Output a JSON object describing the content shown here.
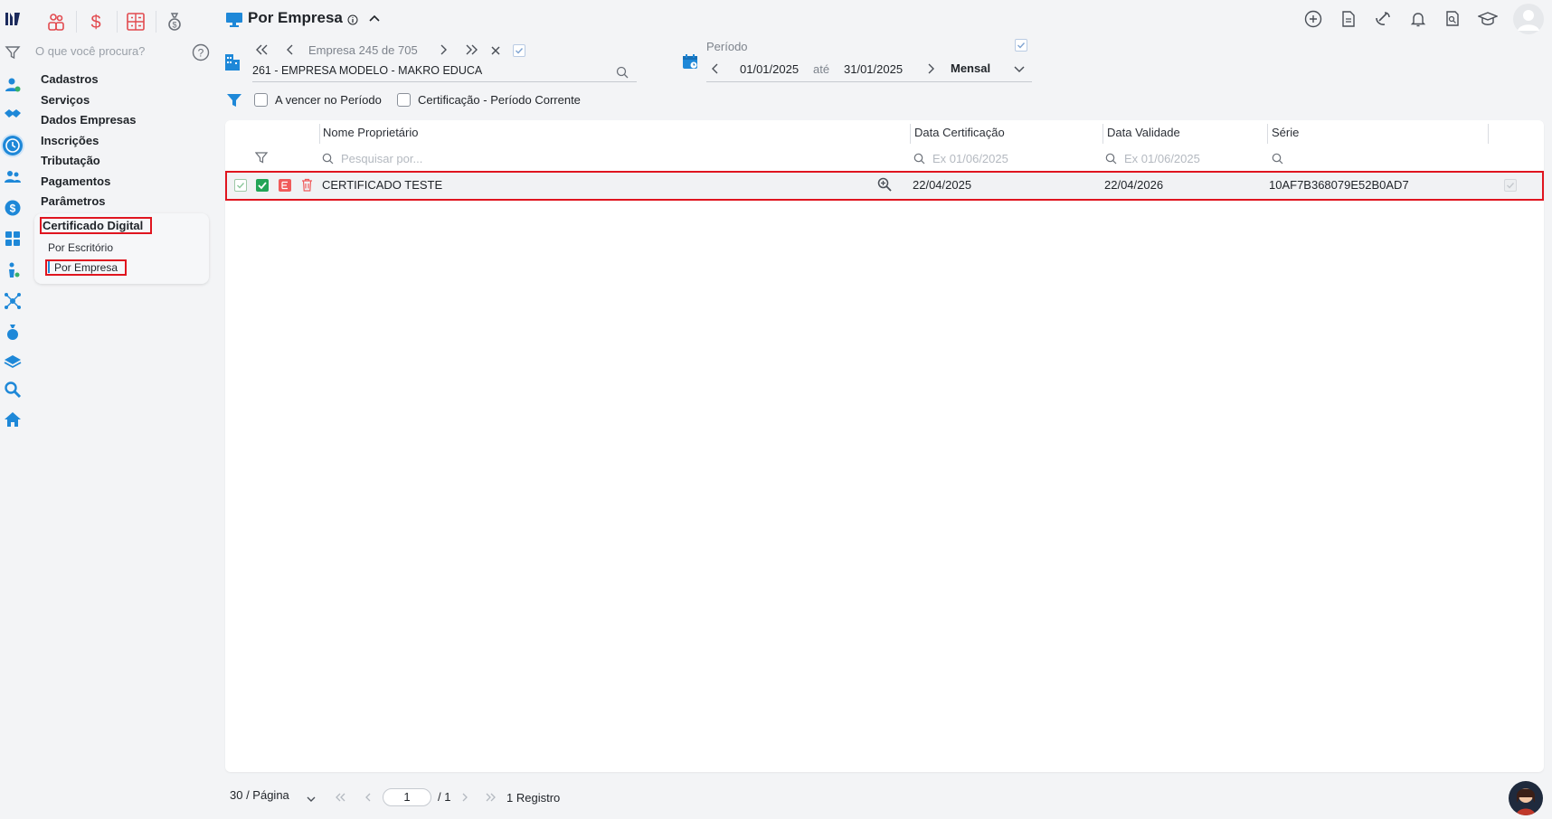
{
  "app": {
    "logo": "makro-logo"
  },
  "modules": [
    {
      "icon": "people-icon",
      "color": "#e24a4f"
    },
    {
      "icon": "dollar-icon",
      "color": "#e24a4f"
    },
    {
      "icon": "calculator-icon",
      "color": "#e24a4f"
    },
    {
      "icon": "money-bag-icon",
      "color": "#6b7078"
    }
  ],
  "sidebar": {
    "search_placeholder": "O que você procura?",
    "items": [
      {
        "label": "Cadastros"
      },
      {
        "label": "Serviços"
      },
      {
        "label": "Dados Empresas"
      },
      {
        "label": "Inscrições"
      },
      {
        "label": "Tributação"
      },
      {
        "label": "Pagamentos"
      },
      {
        "label": "Parâmetros"
      }
    ],
    "active_group": {
      "label": "Certificado Digital",
      "children": [
        {
          "label": "Por Escritório"
        },
        {
          "label": "Por Empresa"
        }
      ]
    }
  },
  "header": {
    "title": "Por Empresa"
  },
  "company_nav": {
    "counter": "Empresa 245 de 705",
    "company": "261 - EMPRESA MODELO - MAKRO EDUCA"
  },
  "period": {
    "label": "Período",
    "from": "01/01/2025",
    "to_label": "até",
    "to": "31/01/2025",
    "granularity": "Mensal"
  },
  "filters": {
    "a_vencer": "A vencer no Período",
    "certificacao": "Certificação - Período Corrente"
  },
  "table": {
    "columns": {
      "owner": "Nome Proprietário",
      "cert_date": "Data Certificação",
      "valid_date": "Data Validade",
      "serie": "Série"
    },
    "placeholders": {
      "owner": "Pesquisar por...",
      "cert_date": "Ex 01/06/2025",
      "valid_date": "Ex 01/06/2025"
    },
    "rows": [
      {
        "owner": "CERTIFICADO TESTE",
        "cert_date": "22/04/2025",
        "valid_date": "22/04/2026",
        "serie": "10AF7B368079E52B0AD7"
      }
    ]
  },
  "pager": {
    "per_page": "30 / Página",
    "page": "1",
    "total_pages": "/ 1",
    "records": "1 Registro"
  },
  "colors": {
    "accent": "#1e88d8",
    "highlight": "#e0151f",
    "edit_badge": "#f05a5a",
    "check_green": "#23a457"
  }
}
